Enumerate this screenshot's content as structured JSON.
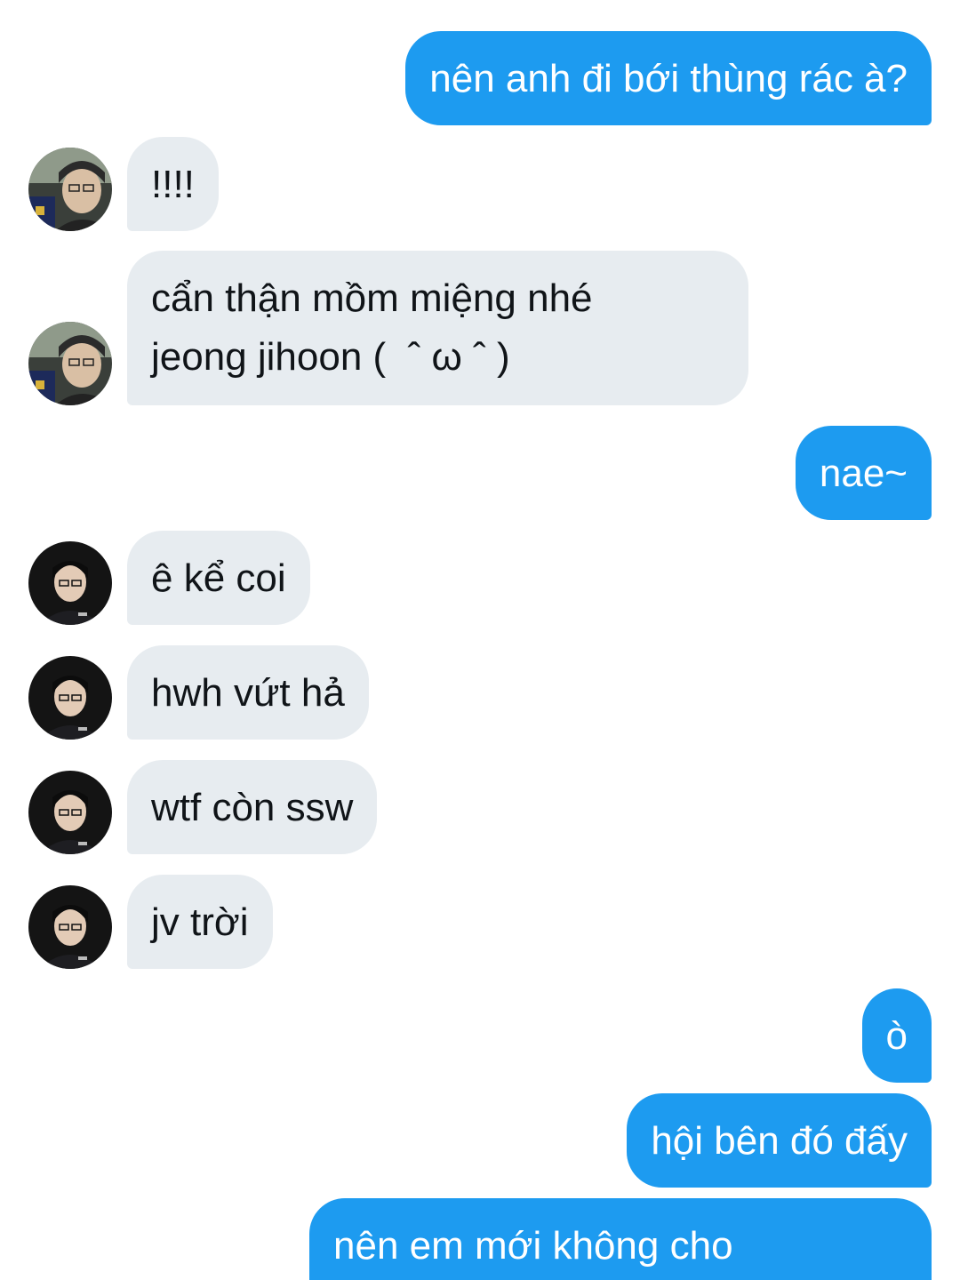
{
  "messages": [
    {
      "side": "out",
      "text": "nên anh đi bới thùng rác à?"
    },
    {
      "side": "in",
      "avatar": "user-a",
      "text": "!!!!"
    },
    {
      "side": "in",
      "avatar": "user-a",
      "text": "cẩn thận mồm miệng nhé\njeong jihoon (  ˆ ω ˆ )"
    },
    {
      "side": "out",
      "text": "nae~"
    },
    {
      "side": "in",
      "avatar": "user-b",
      "text": "ê kể coi"
    },
    {
      "side": "in",
      "avatar": "user-b",
      "text": "hwh vứt hả"
    },
    {
      "side": "in",
      "avatar": "user-b",
      "text": "wtf còn ssw"
    },
    {
      "side": "in",
      "avatar": "user-b",
      "text": "jv trời"
    },
    {
      "side": "out",
      "text": "ò"
    },
    {
      "side": "out",
      "text": "hội bên đó đấy"
    },
    {
      "side": "out",
      "text": "nên em mới không cho"
    }
  ],
  "colors": {
    "outgoing_bubble": "#1d9bf0",
    "incoming_bubble": "#e7ecf0",
    "background": "#ffffff"
  }
}
